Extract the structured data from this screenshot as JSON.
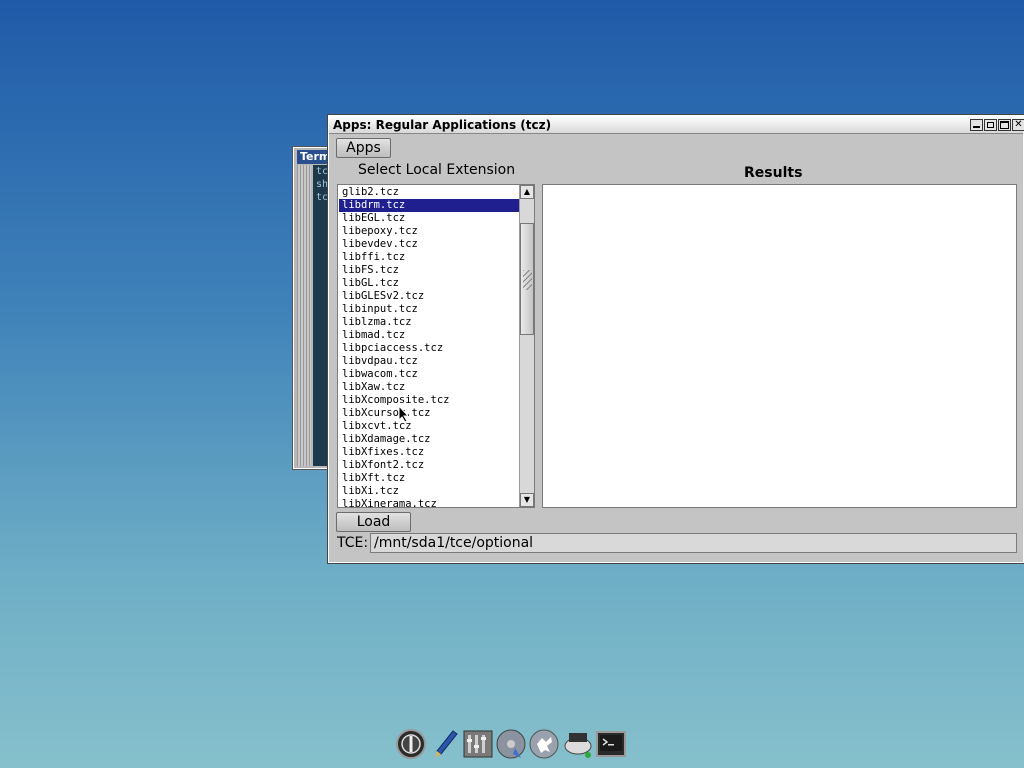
{
  "terminal": {
    "title": "Term",
    "lines": [
      "tc",
      "sh",
      "tc"
    ]
  },
  "apps_window": {
    "title": "Apps: Regular Applications (tcz)",
    "apps_button": "Apps",
    "select_label": "Select Local Extension",
    "results_label": "Results",
    "extensions": [
      "glib2.tcz",
      "libdrm.tcz",
      "libEGL.tcz",
      "libepoxy.tcz",
      "libevdev.tcz",
      "libffi.tcz",
      "libFS.tcz",
      "libGL.tcz",
      "libGLESv2.tcz",
      "libinput.tcz",
      "liblzma.tcz",
      "libmad.tcz",
      "libpciaccess.tcz",
      "libvdpau.tcz",
      "libwacom.tcz",
      "libXaw.tcz",
      "libXcomposite.tcz",
      "libXcursor.tcz",
      "libxcvt.tcz",
      "libXdamage.tcz",
      "libXfixes.tcz",
      "libXfont2.tcz",
      "libXft.tcz",
      "libXi.tcz",
      "libXinerama.tcz"
    ],
    "selected_extension": "libdrm.tcz",
    "load_button": "Load",
    "tce_label": "TCE:",
    "tce_path": "/mnt/sda1/tce/optional"
  },
  "dock": {
    "icons": [
      "power-icon",
      "editor-icon",
      "control-panel-icon",
      "mount-tool-icon",
      "apps-icon",
      "backup-icon",
      "terminal-icon"
    ]
  }
}
